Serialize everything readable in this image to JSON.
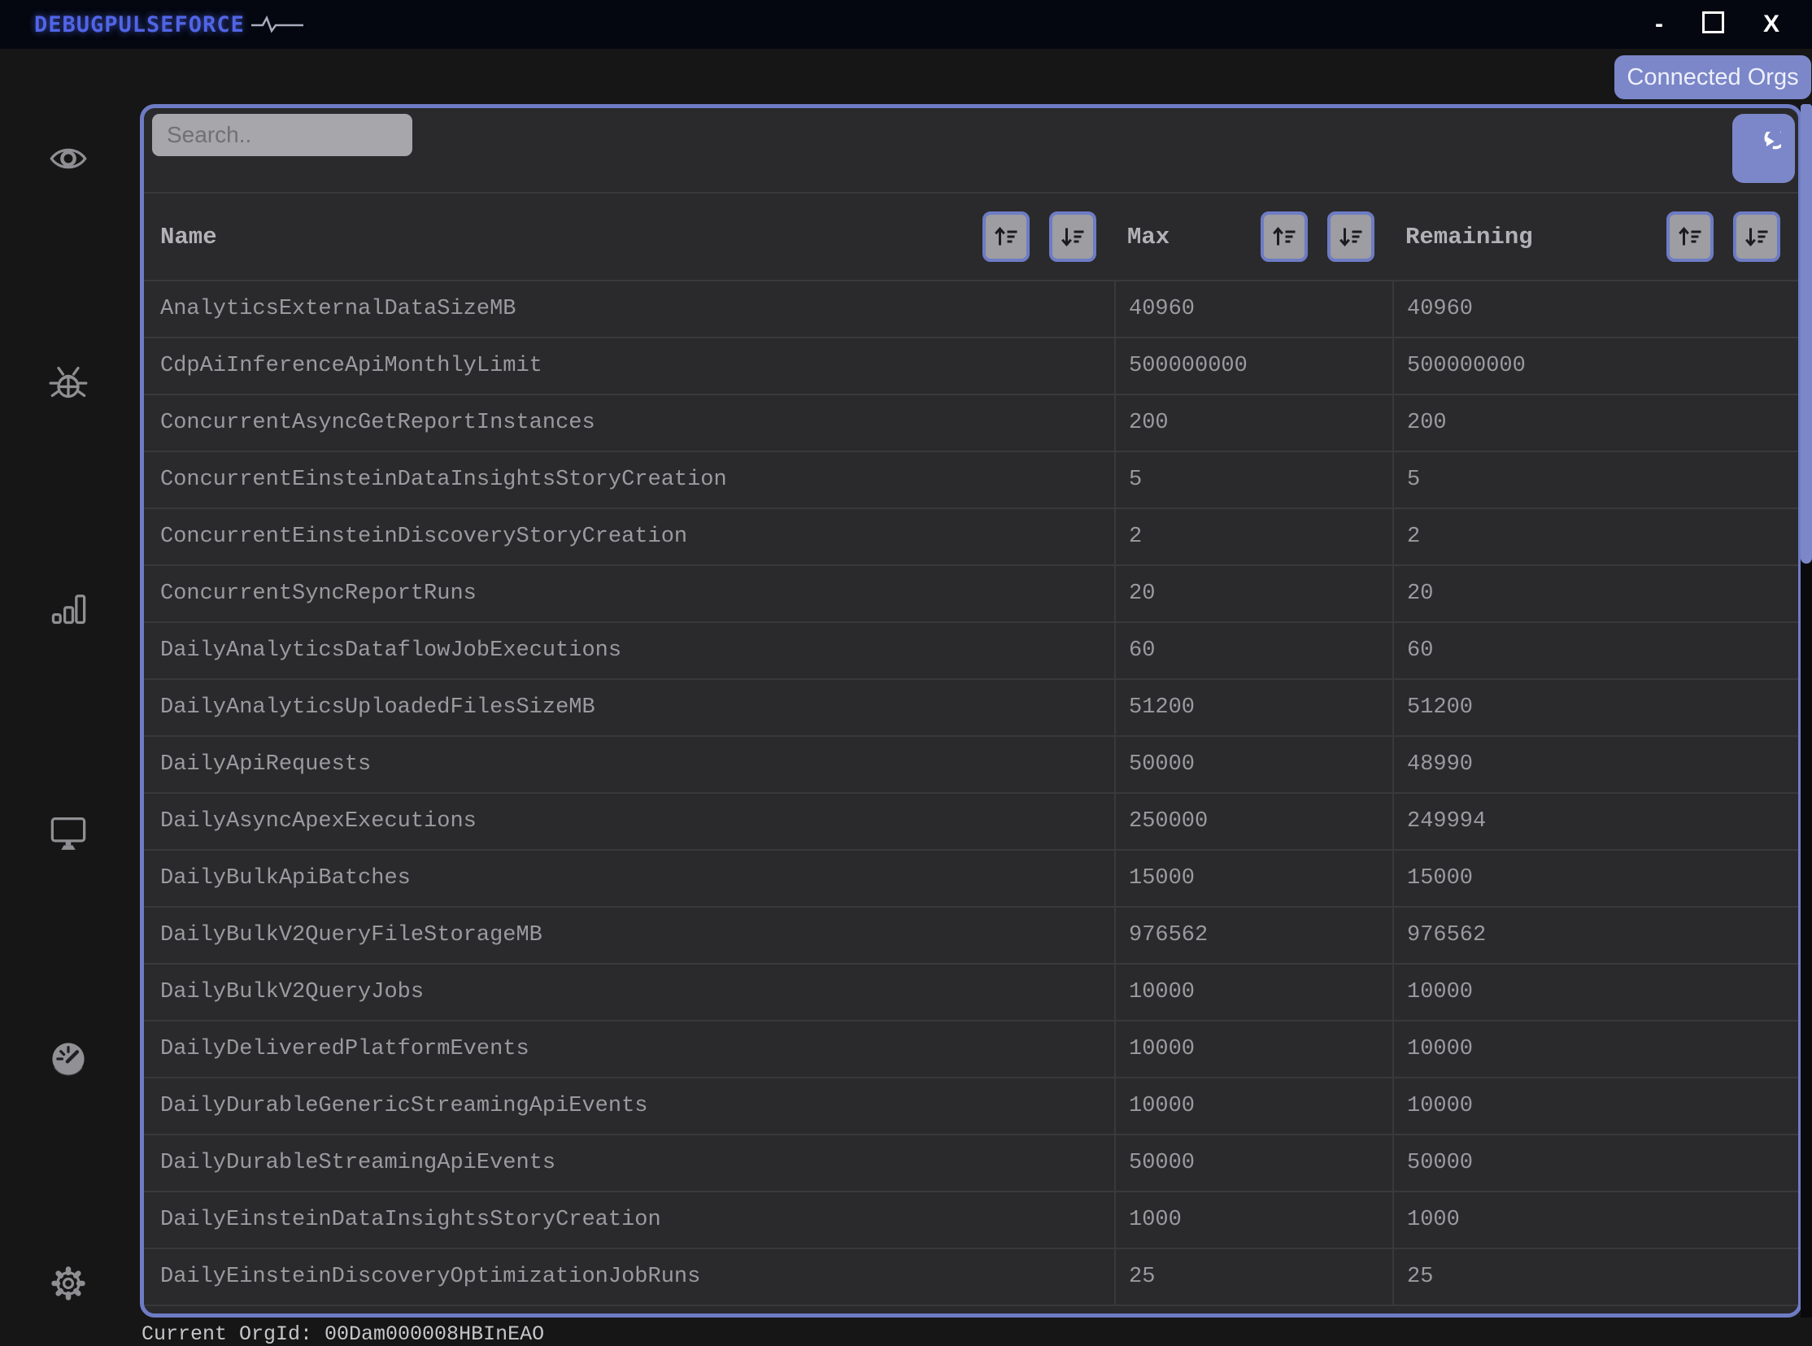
{
  "titlebar": {
    "app_name": "DEBUGPULSEFORCE",
    "minimize_label": "-",
    "close_label": "X"
  },
  "toolbar": {
    "connected_orgs_label": "Connected Orgs",
    "search_placeholder": "Search.."
  },
  "sidebar": {
    "items": [
      {
        "icon": "eye-icon"
      },
      {
        "icon": "bug-icon"
      },
      {
        "icon": "bar-chart-icon"
      },
      {
        "icon": "monitor-icon"
      },
      {
        "icon": "gauge-icon"
      },
      {
        "icon": "gear-icon"
      }
    ]
  },
  "table": {
    "columns": [
      {
        "label": "Name"
      },
      {
        "label": "Max"
      },
      {
        "label": "Remaining"
      }
    ],
    "rows": [
      {
        "name": "AnalyticsExternalDataSizeMB",
        "max": "40960",
        "remaining": "40960"
      },
      {
        "name": "CdpAiInferenceApiMonthlyLimit",
        "max": "500000000",
        "remaining": "500000000"
      },
      {
        "name": "ConcurrentAsyncGetReportInstances",
        "max": "200",
        "remaining": "200"
      },
      {
        "name": "ConcurrentEinsteinDataInsightsStoryCreation",
        "max": "5",
        "remaining": "5"
      },
      {
        "name": "ConcurrentEinsteinDiscoveryStoryCreation",
        "max": "2",
        "remaining": "2"
      },
      {
        "name": "ConcurrentSyncReportRuns",
        "max": "20",
        "remaining": "20"
      },
      {
        "name": "DailyAnalyticsDataflowJobExecutions",
        "max": "60",
        "remaining": "60"
      },
      {
        "name": "DailyAnalyticsUploadedFilesSizeMB",
        "max": "51200",
        "remaining": "51200"
      },
      {
        "name": "DailyApiRequests",
        "max": "50000",
        "remaining": "48990"
      },
      {
        "name": "DailyAsyncApexExecutions",
        "max": "250000",
        "remaining": "249994"
      },
      {
        "name": "DailyBulkApiBatches",
        "max": "15000",
        "remaining": "15000"
      },
      {
        "name": "DailyBulkV2QueryFileStorageMB",
        "max": "976562",
        "remaining": "976562"
      },
      {
        "name": "DailyBulkV2QueryJobs",
        "max": "10000",
        "remaining": "10000"
      },
      {
        "name": "DailyDeliveredPlatformEvents",
        "max": "10000",
        "remaining": "10000"
      },
      {
        "name": "DailyDurableGenericStreamingApiEvents",
        "max": "10000",
        "remaining": "10000"
      },
      {
        "name": "DailyDurableStreamingApiEvents",
        "max": "50000",
        "remaining": "50000"
      },
      {
        "name": "DailyEinsteinDataInsightsStoryCreation",
        "max": "1000",
        "remaining": "1000"
      },
      {
        "name": "DailyEinsteinDiscoveryOptimizationJobRuns",
        "max": "25",
        "remaining": "25"
      }
    ]
  },
  "statusbar": {
    "text": "Current OrgId: 00Dam000008HBInEAO"
  },
  "colors": {
    "accent": "#7b87c9",
    "panel_border": "#6e7cc5",
    "panel_bg": "#2a2a2c",
    "titlebar_bg": "#04070f",
    "logo_blue": "#5065e6",
    "body_bg": "#161616"
  }
}
